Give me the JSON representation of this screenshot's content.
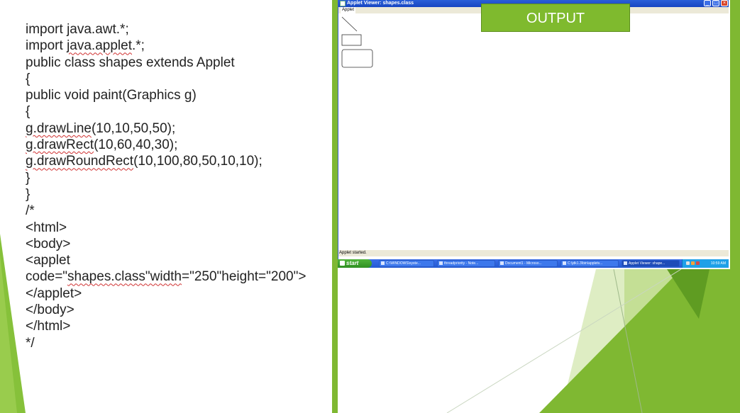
{
  "code": {
    "lines": [
      {
        "parts": [
          {
            "t": "import "
          },
          {
            "t": "java.awt.*;"
          }
        ]
      },
      {
        "parts": [
          {
            "t": "import "
          },
          {
            "t": "java.applet",
            "sq": true
          },
          {
            "t": ".*;"
          }
        ]
      },
      {
        "parts": [
          {
            "t": "public class shapes extends Applet"
          }
        ]
      },
      {
        "parts": [
          {
            "t": "{"
          }
        ]
      },
      {
        "parts": [
          {
            "t": "public void paint(Graphics g)"
          }
        ]
      },
      {
        "parts": [
          {
            "t": "{"
          }
        ]
      },
      {
        "parts": [
          {
            "t": "g.drawLine",
            "sq": true
          },
          {
            "t": "(10,10,50,50);"
          }
        ]
      },
      {
        "parts": [
          {
            "t": "g.drawRect",
            "sq": true
          },
          {
            "t": "(10,60,40,30);"
          }
        ]
      },
      {
        "parts": [
          {
            "t": "g.drawRoundRect",
            "sq": true
          },
          {
            "t": "(10,100,80,50,10,10);"
          }
        ]
      },
      {
        "parts": [
          {
            "t": "}"
          }
        ]
      },
      {
        "parts": [
          {
            "t": "}"
          }
        ]
      },
      {
        "parts": [
          {
            "t": "/*"
          }
        ]
      },
      {
        "parts": [
          {
            "t": "<html>"
          }
        ]
      },
      {
        "parts": [
          {
            "t": "<body>"
          }
        ]
      },
      {
        "parts": [
          {
            "t": "<applet"
          }
        ]
      },
      {
        "parts": [
          {
            "t": "code=\""
          },
          {
            "t": "shapes.class\"width",
            "sq": true
          },
          {
            "t": "=\"250\"height=\"200\">"
          }
        ]
      },
      {
        "parts": [
          {
            "t": "</applet>"
          }
        ]
      },
      {
        "parts": [
          {
            "t": "</body>"
          }
        ]
      },
      {
        "parts": [
          {
            "t": "</html>"
          }
        ]
      },
      {
        "parts": [
          {
            "t": "*/"
          }
        ]
      }
    ]
  },
  "applet_window": {
    "title": "Applet Viewer: shapes.class",
    "menu_label": "Applet",
    "status": "Applet started.",
    "buttons": {
      "minimize": "_",
      "maximize": "□",
      "close": "×"
    }
  },
  "output_label": "OUTPUT",
  "taskbar": {
    "start_label": "start",
    "items": [
      {
        "label": "C:\\WINDOWS\\syste..."
      },
      {
        "label": "threadpriority - Note..."
      },
      {
        "label": "Document1 - Microso..."
      },
      {
        "label": "C:\\jdk1.3\\bin\\appletv..."
      },
      {
        "label": "Applet Viewer: shape...",
        "active": true
      }
    ],
    "time": "10:59 AM"
  },
  "colors": {
    "accent_green": "#7fb832",
    "title_blue": "#245ad4",
    "squiggle": "#d03030"
  }
}
